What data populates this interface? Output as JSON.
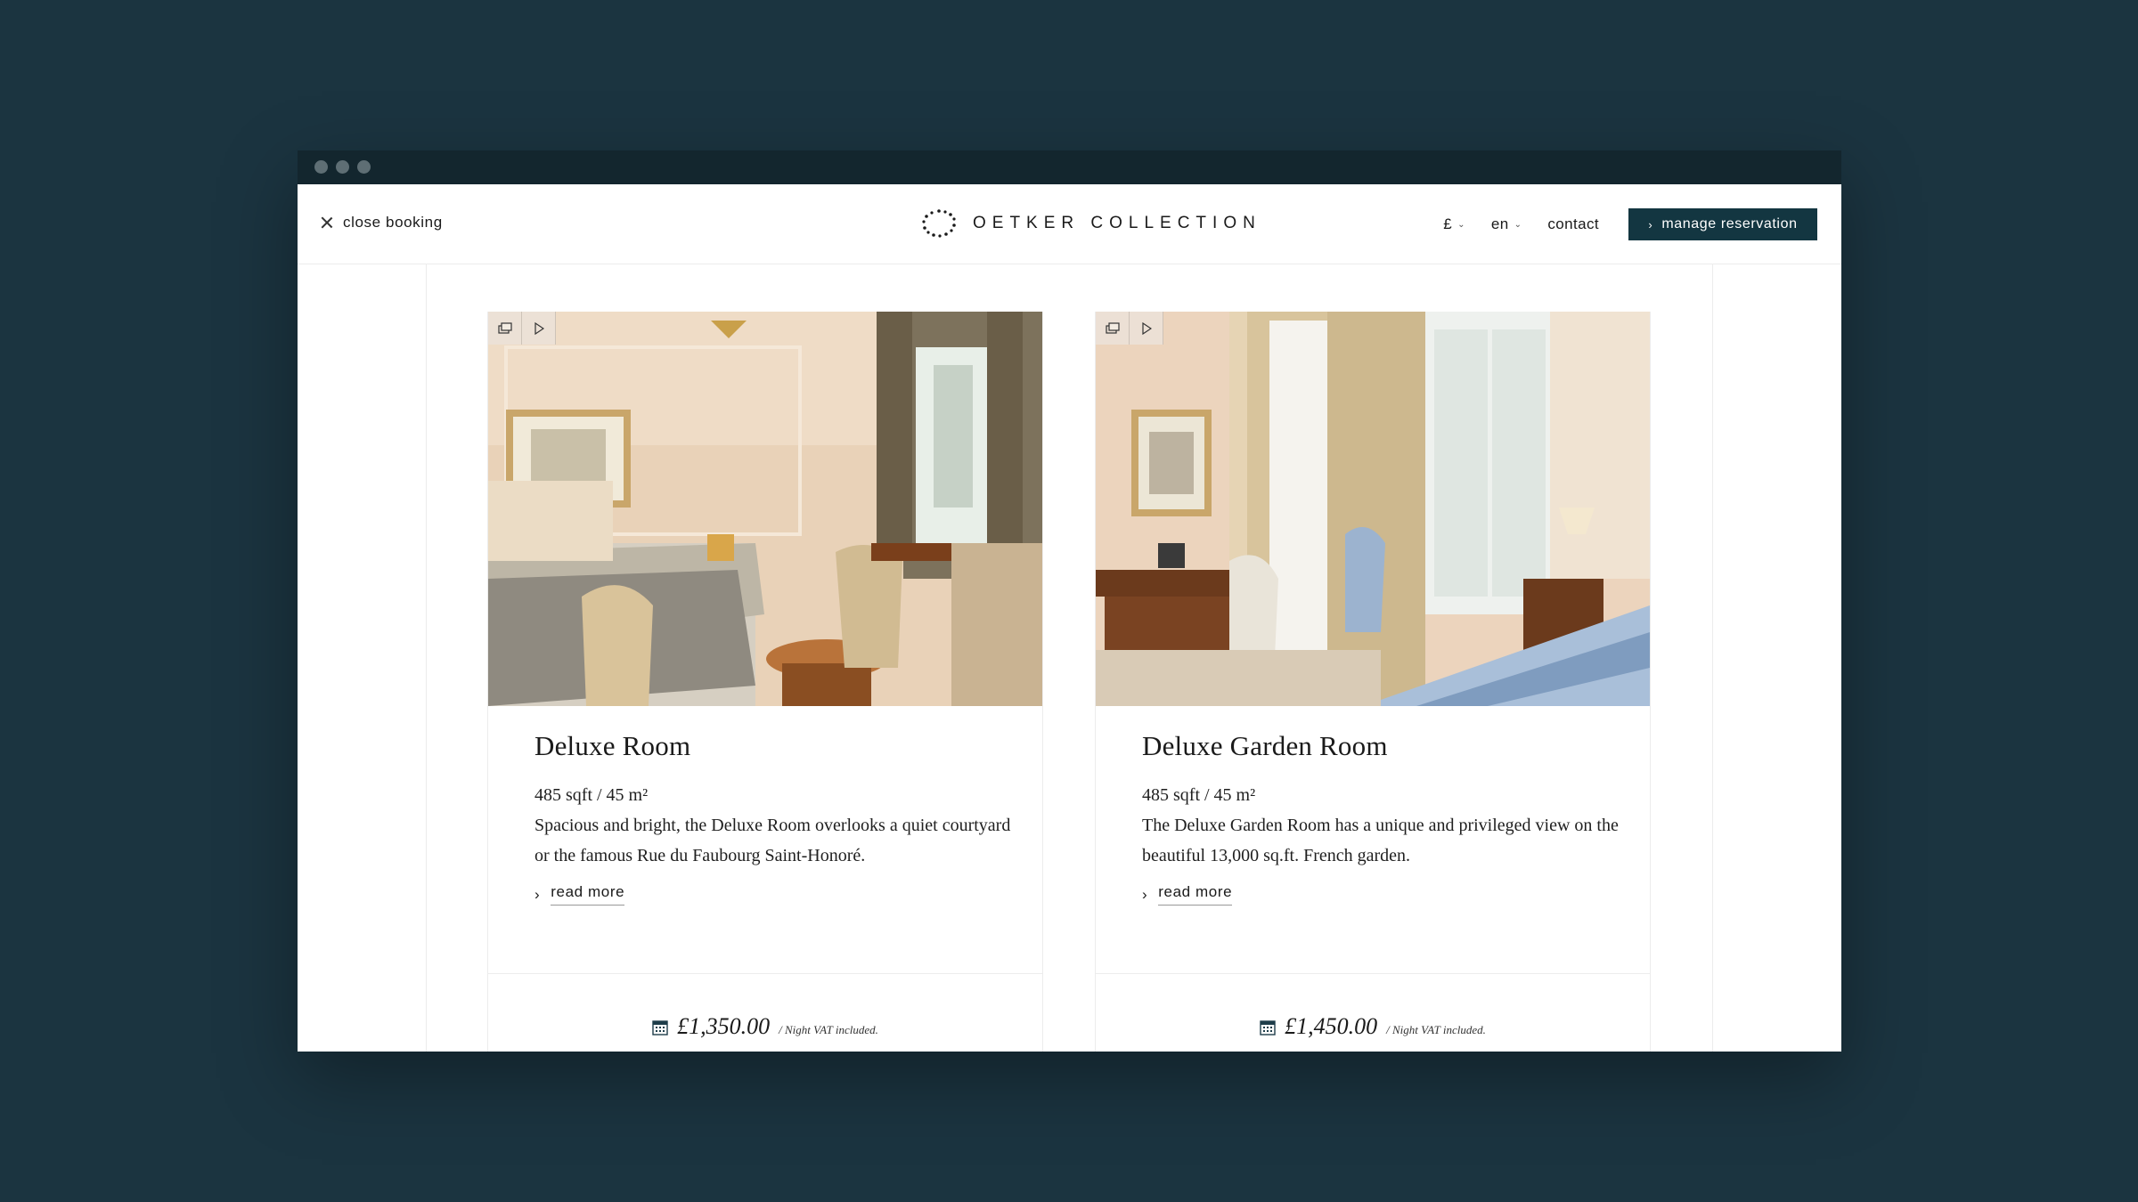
{
  "header": {
    "close_label": "close booking",
    "brand": "OETKER COLLECTION",
    "currency": "£",
    "language": "en",
    "contact": "contact",
    "manage": "manage reservation"
  },
  "rooms": [
    {
      "title": "Deluxe Room",
      "size": "485 sqft / 45 m²",
      "description": "Spacious and bright, the Deluxe Room overlooks a quiet courtyard or the famous Rue du Faubourg Saint-Honoré.",
      "read_more": "read more",
      "price": "£1,350.00",
      "price_note": "/ Night VAT included."
    },
    {
      "title": "Deluxe Garden Room",
      "size": "485 sqft / 45 m²",
      "description": "The Deluxe Garden Room has a unique and privileged view on the beautiful 13,000 sq.ft. French garden.",
      "read_more": "read more",
      "price": "£1,450.00",
      "price_note": "/ Night VAT included."
    }
  ],
  "colors": {
    "page_background": "#1b3440",
    "titlebar": "#13262e",
    "accent": "#133641"
  }
}
